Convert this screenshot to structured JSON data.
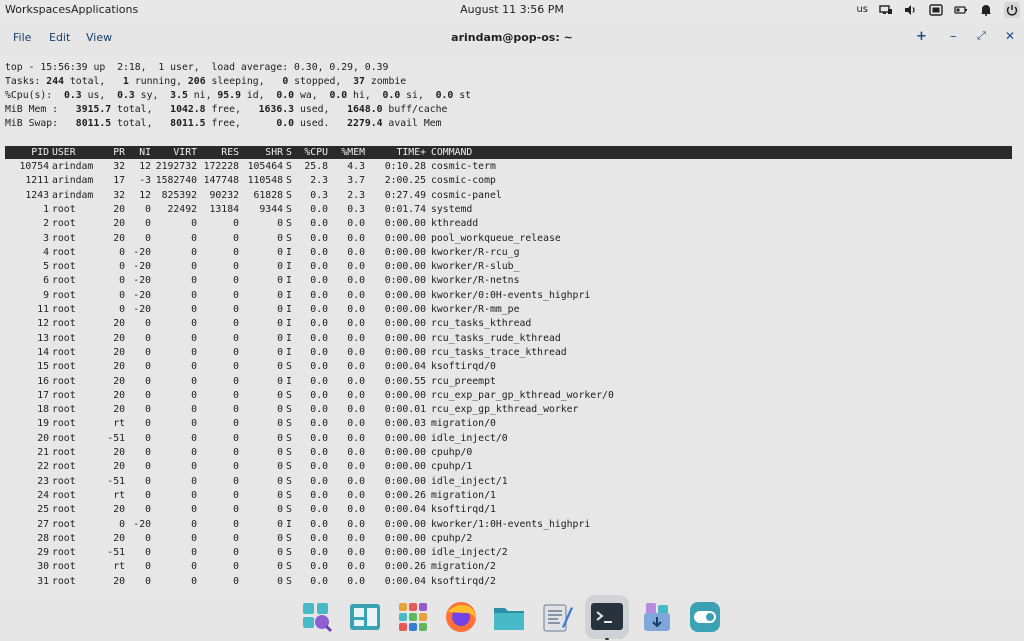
{
  "panel": {
    "workspaces": "Workspaces",
    "applications": "Applications",
    "clock": "August 11 3:56 PM",
    "lang": "us",
    "tray_icons": [
      "network-icon",
      "volume-icon",
      "screenshot-icon",
      "battery-icon",
      "notifications-icon",
      "power-icon"
    ]
  },
  "window": {
    "menu": [
      "File",
      "Edit",
      "View"
    ],
    "title": "arindam@pop-os: ~",
    "buttons": [
      "+",
      "–",
      "⤢",
      "✕"
    ]
  },
  "top": {
    "l1": "top - 15:56:39 up  2:18,  1 user,  load average: 0.30, 0.29, 0.39",
    "tasks": {
      "label": "Tasks:",
      "total": "244",
      "total_l": "total,",
      "running": "1",
      "running_l": "running,",
      "sleeping": "206",
      "sleeping_l": "sleeping,",
      "stopped": "0",
      "stopped_l": "stopped,",
      "zombie": "37",
      "zombie_l": "zombie"
    },
    "cpu": {
      "label": "%Cpu(s):",
      "us": "0.3",
      "sy": "0.3",
      "ni": "3.5",
      "id": "95.9",
      "wa": "0.0",
      "hi": "0.0",
      "si": "0.0",
      "st": "0.0"
    },
    "mem": {
      "label": "MiB Mem :",
      "total": "3915.7",
      "free": "1042.8",
      "used": "1636.3",
      "buff": "1648.0"
    },
    "swap": {
      "label": "MiB Swap:",
      "total": "8011.5",
      "free": "8011.5",
      "used": "0.0",
      "avail": "2279.4"
    }
  },
  "columns": [
    "PID",
    "USER",
    "PR",
    "NI",
    "VIRT",
    "RES",
    "SHR",
    "S",
    "%CPU",
    "%MEM",
    "TIME+",
    "COMMAND"
  ],
  "processes": [
    [
      "10754",
      "arindam",
      "32",
      "12",
      "2192732",
      "172228",
      "105464",
      "S",
      "25.8",
      "4.3",
      "0:10.28",
      "cosmic-term"
    ],
    [
      "1211",
      "arindam",
      "17",
      "-3",
      "1582740",
      "147748",
      "110548",
      "S",
      "2.3",
      "3.7",
      "2:00.25",
      "cosmic-comp"
    ],
    [
      "1243",
      "arindam",
      "32",
      "12",
      "825392",
      "90232",
      "61828",
      "S",
      "0.3",
      "2.3",
      "0:27.49",
      "cosmic-panel"
    ],
    [
      "1",
      "root",
      "20",
      "0",
      "22492",
      "13184",
      "9344",
      "S",
      "0.0",
      "0.3",
      "0:01.74",
      "systemd"
    ],
    [
      "2",
      "root",
      "20",
      "0",
      "0",
      "0",
      "0",
      "S",
      "0.0",
      "0.0",
      "0:00.00",
      "kthreadd"
    ],
    [
      "3",
      "root",
      "20",
      "0",
      "0",
      "0",
      "0",
      "S",
      "0.0",
      "0.0",
      "0:00.00",
      "pool_workqueue_release"
    ],
    [
      "4",
      "root",
      "0",
      "-20",
      "0",
      "0",
      "0",
      "I",
      "0.0",
      "0.0",
      "0:00.00",
      "kworker/R-rcu_g"
    ],
    [
      "5",
      "root",
      "0",
      "-20",
      "0",
      "0",
      "0",
      "I",
      "0.0",
      "0.0",
      "0:00.00",
      "kworker/R-slub_"
    ],
    [
      "6",
      "root",
      "0",
      "-20",
      "0",
      "0",
      "0",
      "I",
      "0.0",
      "0.0",
      "0:00.00",
      "kworker/R-netns"
    ],
    [
      "9",
      "root",
      "0",
      "-20",
      "0",
      "0",
      "0",
      "I",
      "0.0",
      "0.0",
      "0:00.00",
      "kworker/0:0H-events_highpri"
    ],
    [
      "11",
      "root",
      "0",
      "-20",
      "0",
      "0",
      "0",
      "I",
      "0.0",
      "0.0",
      "0:00.00",
      "kworker/R-mm_pe"
    ],
    [
      "12",
      "root",
      "20",
      "0",
      "0",
      "0",
      "0",
      "I",
      "0.0",
      "0.0",
      "0:00.00",
      "rcu_tasks_kthread"
    ],
    [
      "13",
      "root",
      "20",
      "0",
      "0",
      "0",
      "0",
      "I",
      "0.0",
      "0.0",
      "0:00.00",
      "rcu_tasks_rude_kthread"
    ],
    [
      "14",
      "root",
      "20",
      "0",
      "0",
      "0",
      "0",
      "I",
      "0.0",
      "0.0",
      "0:00.00",
      "rcu_tasks_trace_kthread"
    ],
    [
      "15",
      "root",
      "20",
      "0",
      "0",
      "0",
      "0",
      "S",
      "0.0",
      "0.0",
      "0:00.04",
      "ksoftirqd/0"
    ],
    [
      "16",
      "root",
      "20",
      "0",
      "0",
      "0",
      "0",
      "I",
      "0.0",
      "0.0",
      "0:00.55",
      "rcu_preempt"
    ],
    [
      "17",
      "root",
      "20",
      "0",
      "0",
      "0",
      "0",
      "S",
      "0.0",
      "0.0",
      "0:00.00",
      "rcu_exp_par_gp_kthread_worker/0"
    ],
    [
      "18",
      "root",
      "20",
      "0",
      "0",
      "0",
      "0",
      "S",
      "0.0",
      "0.0",
      "0:00.01",
      "rcu_exp_gp_kthread_worker"
    ],
    [
      "19",
      "root",
      "rt",
      "0",
      "0",
      "0",
      "0",
      "S",
      "0.0",
      "0.0",
      "0:00.03",
      "migration/0"
    ],
    [
      "20",
      "root",
      "-51",
      "0",
      "0",
      "0",
      "0",
      "S",
      "0.0",
      "0.0",
      "0:00.00",
      "idle_inject/0"
    ],
    [
      "21",
      "root",
      "20",
      "0",
      "0",
      "0",
      "0",
      "S",
      "0.0",
      "0.0",
      "0:00.00",
      "cpuhp/0"
    ],
    [
      "22",
      "root",
      "20",
      "0",
      "0",
      "0",
      "0",
      "S",
      "0.0",
      "0.0",
      "0:00.00",
      "cpuhp/1"
    ],
    [
      "23",
      "root",
      "-51",
      "0",
      "0",
      "0",
      "0",
      "S",
      "0.0",
      "0.0",
      "0:00.00",
      "idle_inject/1"
    ],
    [
      "24",
      "root",
      "rt",
      "0",
      "0",
      "0",
      "0",
      "S",
      "0.0",
      "0.0",
      "0:00.26",
      "migration/1"
    ],
    [
      "25",
      "root",
      "20",
      "0",
      "0",
      "0",
      "0",
      "S",
      "0.0",
      "0.0",
      "0:00.04",
      "ksoftirqd/1"
    ],
    [
      "27",
      "root",
      "0",
      "-20",
      "0",
      "0",
      "0",
      "I",
      "0.0",
      "0.0",
      "0:00.00",
      "kworker/1:0H-events_highpri"
    ],
    [
      "28",
      "root",
      "20",
      "0",
      "0",
      "0",
      "0",
      "S",
      "0.0",
      "0.0",
      "0:00.00",
      "cpuhp/2"
    ],
    [
      "29",
      "root",
      "-51",
      "0",
      "0",
      "0",
      "0",
      "S",
      "0.0",
      "0.0",
      "0:00.00",
      "idle_inject/2"
    ],
    [
      "30",
      "root",
      "rt",
      "0",
      "0",
      "0",
      "0",
      "S",
      "0.0",
      "0.0",
      "0:00.26",
      "migration/2"
    ],
    [
      "31",
      "root",
      "20",
      "0",
      "0",
      "0",
      "0",
      "S",
      "0.0",
      "0.0",
      "0:00.04",
      "ksoftirqd/2"
    ]
  ],
  "dock": [
    "launcher-icon",
    "workspaces-icon",
    "app-library-icon",
    "firefox-icon",
    "files-icon",
    "text-editor-icon",
    "terminal-icon",
    "store-icon",
    "settings-icon"
  ],
  "colors": {
    "accent": "#1a4c85",
    "header_bg": "#2a2a2a",
    "terminal_bg": "#e7e7e7"
  }
}
